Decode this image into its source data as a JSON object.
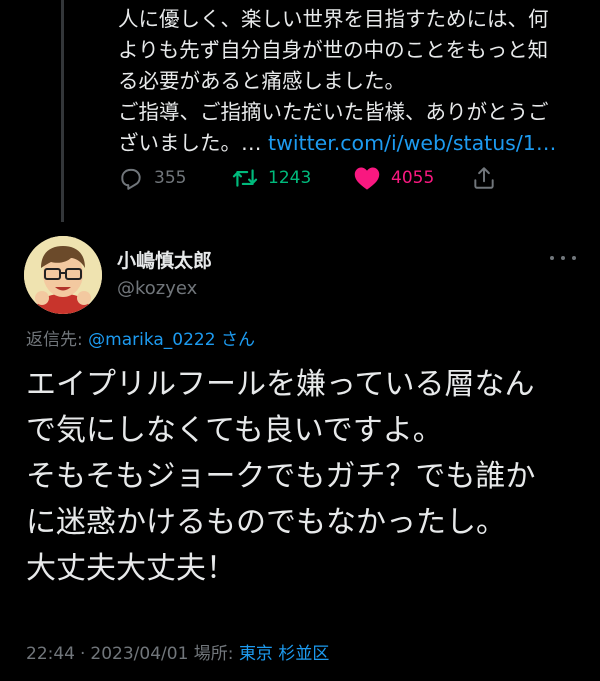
{
  "previous_tweet": {
    "lines": [
      "人に優しく、楽しい世界を目指すためには、何",
      "よりも先ず自分自身が世の中のことをもっと知",
      "る必要があると痛感しました。",
      "ご指導、ご指摘いただいた皆様、ありがとうご"
    ],
    "last_line_text": "ざいました。…",
    "link_text": "twitter.com/i/web/status/1…",
    "reply_count": "355",
    "retweet_count": "1243",
    "like_count": "4055"
  },
  "tweet": {
    "author_name": "小嶋慎太郎",
    "author_handle": "@kozyex",
    "reply_prefix": "返信先:",
    "reply_mention": "@marika_0222",
    "reply_suffix": "さん",
    "lines": [
      "エイプリルフールを嫌っている層なん",
      "で気にしなくても良いですよ。",
      "そもそもジョークでもガチ？でも誰か",
      "に迷惑かけるものでもなかったし。",
      "大丈夫大丈夫！"
    ],
    "time": "22:44",
    "separator": "·",
    "date": "2023/04/01",
    "location_label": "場所:",
    "location": "東京 杉並区"
  },
  "colors": {
    "background": "#000000",
    "text": "#e7e9ea",
    "muted": "#71767b",
    "link": "#1d9bf0",
    "retweet": "#00ba7c",
    "like": "#f91880"
  },
  "icons": [
    "reply-icon",
    "retweet-icon",
    "like-icon",
    "share-icon",
    "more-icon"
  ]
}
